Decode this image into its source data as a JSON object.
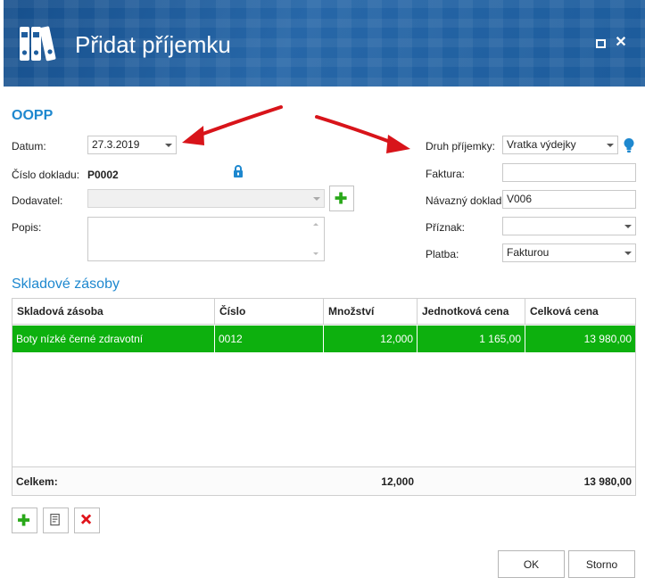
{
  "window": {
    "title": "Přidat příjemku"
  },
  "form": {
    "section_title": "OOPP",
    "datum_label": "Datum:",
    "datum_value": "27.3.2019",
    "cislo_label": "Číslo dokladu:",
    "cislo_value": "P0002",
    "dodavatel_label": "Dodavatel:",
    "dodavatel_value": "",
    "popis_label": "Popis:",
    "popis_value": "",
    "druh_label": "Druh příjemky:",
    "druh_value": "Vratka výdejky",
    "faktura_label": "Faktura:",
    "faktura_value": "",
    "navazny_label": "Návazný doklad:",
    "navazny_value": "V006",
    "priznak_label": "Příznak:",
    "priznak_value": "",
    "platba_label": "Platba:",
    "platba_value": "Fakturou"
  },
  "grid": {
    "title": "Skladové zásoby",
    "columns": [
      "Skladová zásoba",
      "Číslo",
      "Množství",
      "Jednotková cena",
      "Celková cena"
    ],
    "rows": [
      [
        "Boty nízké černé zdravotní",
        "0012",
        "12,000",
        "1 165,00",
        "13 980,00"
      ]
    ],
    "footer": {
      "label": "Celkem:",
      "mnozstvi": "12,000",
      "celkova": "13 980,00"
    }
  },
  "buttons": {
    "ok": "OK",
    "cancel": "Storno"
  },
  "icons": {
    "app": "binders-icon",
    "lock": "lock-icon",
    "bulb": "lightbulb-icon",
    "add": "plus-icon",
    "edit": "document-icon",
    "delete": "x-icon"
  },
  "colors": {
    "titlebar": "#1f5e9e",
    "accent": "#1e88cf",
    "selected_row": "#0db00e",
    "add_green": "#29a819",
    "delete_red": "#e0141b",
    "arrow_red": "#d8141a"
  }
}
